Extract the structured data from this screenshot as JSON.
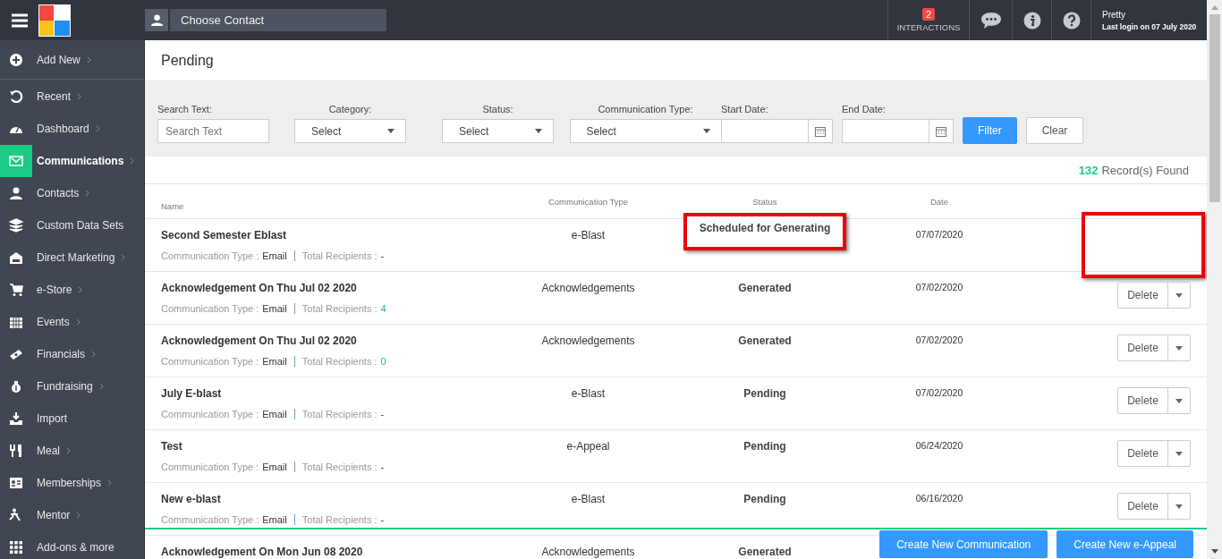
{
  "top_bar": {
    "contact_field": {
      "placeholder": "Choose Contact"
    },
    "interactions": {
      "badge": "2",
      "label": "INTERACTIONS"
    },
    "user": {
      "name": "Pretty",
      "last_login": "Last login on 07 July 2020"
    }
  },
  "sidebar": {
    "items": [
      {
        "label": "Add New",
        "arrow": true,
        "selected": false
      },
      {
        "label": "Recent",
        "arrow": true,
        "selected": false
      },
      {
        "label": "Dashboard",
        "arrow": true,
        "selected": false
      },
      {
        "label": "Communications",
        "arrow": true,
        "selected": true
      },
      {
        "label": "Contacts",
        "arrow": true,
        "selected": false
      },
      {
        "label": "Custom Data Sets",
        "arrow": false,
        "selected": false
      },
      {
        "label": "Direct Marketing",
        "arrow": true,
        "selected": false
      },
      {
        "label": "e-Store",
        "arrow": true,
        "selected": false
      },
      {
        "label": "Events",
        "arrow": true,
        "selected": false
      },
      {
        "label": "Financials",
        "arrow": true,
        "selected": false
      },
      {
        "label": "Fundraising",
        "arrow": true,
        "selected": false
      },
      {
        "label": "Import",
        "arrow": false,
        "selected": false
      },
      {
        "label": "Meal",
        "arrow": true,
        "selected": false
      },
      {
        "label": "Memberships",
        "arrow": true,
        "selected": false
      },
      {
        "label": "Mentor",
        "arrow": true,
        "selected": false
      },
      {
        "label": "Add-ons & more",
        "arrow": false,
        "selected": false
      }
    ]
  },
  "page_title": "Pending",
  "filters": [
    {
      "kind": "text",
      "label": "Search Text:",
      "placeholder": "Search Text"
    },
    {
      "kind": "select",
      "label": "Category:",
      "value": "Select"
    },
    {
      "kind": "select",
      "label": "Status:",
      "value": "Select"
    },
    {
      "kind": "select",
      "label": "Communication Type:",
      "value": "Select"
    },
    {
      "kind": "date",
      "label": "Start Date:"
    },
    {
      "kind": "date",
      "label": "End Date:"
    }
  ],
  "filter_buttons": [
    {
      "label": "Filter",
      "primary": true
    },
    {
      "label": "Clear",
      "primary": false
    }
  ],
  "records": {
    "count": "132",
    "label": "Record(s) Found"
  },
  "table": {
    "columns": [
      "Name",
      "Communication Type",
      "Status",
      "Date"
    ],
    "rows": [
      {
        "name": "Second Semester Eblast",
        "type": "e-Blast",
        "status": "Scheduled for Generating",
        "date": "07/07/2020",
        "detail_label": "Communication Type :",
        "detail_value": "Email",
        "recipients_label": "Total Recipients :",
        "recipients": "-",
        "recipients_linked": false,
        "highlight": true
      },
      {
        "name": "Acknowledgement On Thu Jul 02 2020",
        "type": "Acknowledgements",
        "status": "Generated",
        "date": "07/02/2020",
        "detail_label": "Communication Type :",
        "detail_value": "Email",
        "recipients_label": "Total Recipients :",
        "recipients": "4",
        "recipients_linked": true,
        "action": "Delete",
        "highlight": false
      },
      {
        "name": "Acknowledgement On Thu Jul 02 2020",
        "type": "Acknowledgements",
        "status": "Generated",
        "date": "07/02/2020",
        "detail_label": "Communication Type :",
        "detail_value": "Email",
        "recipients_label": "Total Recipients :",
        "recipients": "0",
        "recipients_linked": true,
        "action": "Delete",
        "highlight": false
      },
      {
        "name": "July E-blast",
        "type": "e-Blast",
        "status": "Pending",
        "date": "07/02/2020",
        "detail_label": "Communication Type :",
        "detail_value": "Email",
        "recipients_label": "Total Recipients :",
        "recipients": "-",
        "recipients_linked": false,
        "action": "Delete",
        "highlight": false
      },
      {
        "name": "Test",
        "type": "e-Appeal",
        "status": "Pending",
        "date": "06/24/2020",
        "detail_label": "Communication Type :",
        "detail_value": "Email",
        "recipients_label": "Total Recipients :",
        "recipients": "-",
        "recipients_linked": false,
        "action": "Delete",
        "highlight": false
      },
      {
        "name": "New e-blast",
        "type": "e-Blast",
        "status": "Pending",
        "date": "06/16/2020",
        "detail_label": "Communication Type :",
        "detail_value": "Email",
        "recipients_label": "Total Recipients :",
        "recipients": "-",
        "recipients_linked": false,
        "action": "Delete",
        "highlight": false
      },
      {
        "name": "Acknowledgement On Mon Jun 08 2020",
        "type": "Acknowledgements",
        "status": "Generated",
        "highlight": false
      }
    ]
  },
  "footer_buttons": [
    "Create New Communication",
    "Create New e-Appeal"
  ]
}
